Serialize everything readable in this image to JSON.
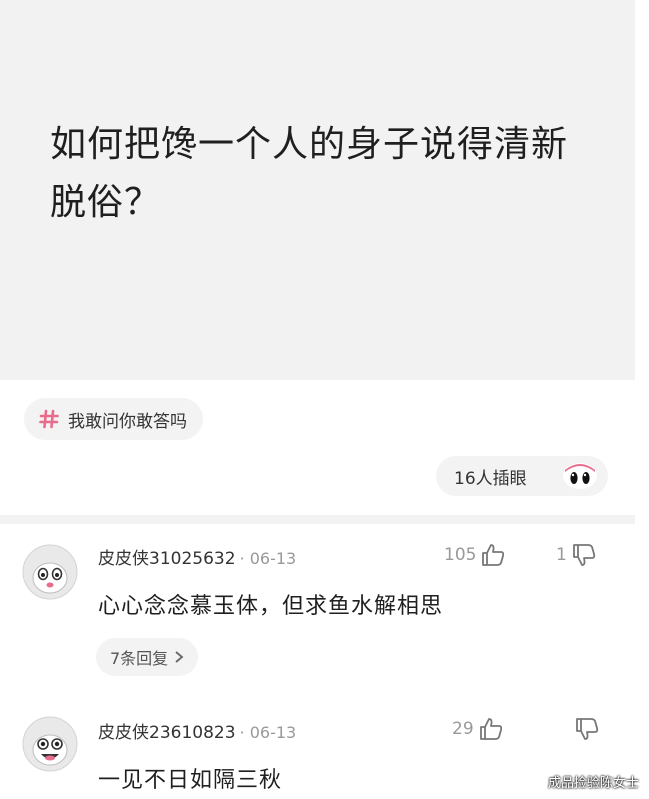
{
  "question": {
    "title": "如何把馋一个人的身子说得清新脱俗？"
  },
  "topic": {
    "label": "我敢问你敢答吗",
    "icon": "hashtag-icon",
    "icon_color": "#e86c8b"
  },
  "peek": {
    "label": "16人插眼",
    "icon": "eyes-icon"
  },
  "comments": [
    {
      "username": "皮皮侠31025632",
      "date": "· 06-13",
      "likes": "105",
      "dislikes": "1",
      "text": "心心念念慕玉体，但求鱼水解相思",
      "reply_label": "7条回复"
    },
    {
      "username": "皮皮侠23610823",
      "date": "· 06-13",
      "likes": "29",
      "text": "一见不日如隔三秋"
    }
  ],
  "watermark": "成品捡验陈女士"
}
